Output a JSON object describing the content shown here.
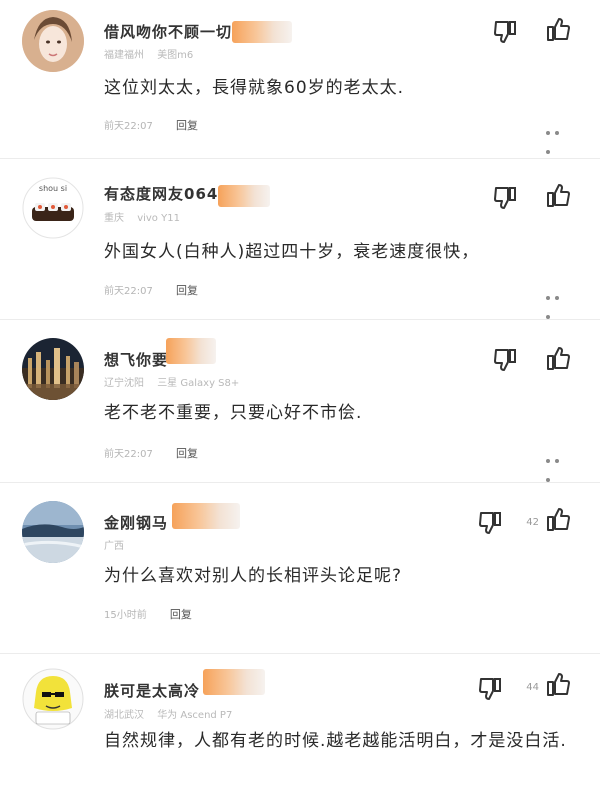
{
  "comments": [
    {
      "username": "借风吻你不顾一切",
      "location": "福建福州",
      "device": "美图m6",
      "text": "这位刘太太，長得就象60岁的老太太.",
      "time": "前天22:07",
      "reply_label": "回复",
      "like_count": ""
    },
    {
      "username": "有态度网友0643l2",
      "location": "重庆",
      "device": "vivo Y11",
      "text": "外国女人(白种人)超过四十岁，衰老速度很快，",
      "time": "前天22:07",
      "reply_label": "回复",
      "like_count": "",
      "avatar_text": "shou si"
    },
    {
      "username": "想飞你要",
      "location": "辽宁沈阳",
      "device": "三星 Galaxy S8+",
      "text": "老不老不重要，只要心好不市侩.",
      "time": "前天22:07",
      "reply_label": "回复",
      "like_count": ""
    },
    {
      "username": "金刚钢马",
      "location": "广西",
      "device": "",
      "text": "为什么喜欢对别人的长相评头论足呢?",
      "time": "15小时前",
      "reply_label": "回复",
      "like_count": "42"
    },
    {
      "username": "朕可是太高冷",
      "location": "湖北武汉",
      "device": "华为 Ascend P7",
      "text": "自然规律，人都有老的时候.越老越能活明白，才是没白活.",
      "time": "",
      "reply_label": "",
      "like_count": "44"
    }
  ],
  "icons": {
    "dislike": "thumbs-down-icon",
    "like": "thumbs-up-icon",
    "more": "more-dots-icon"
  },
  "colors": {
    "badge_accent": "#f6a25a",
    "meta_gray": "#b9b9b9"
  }
}
